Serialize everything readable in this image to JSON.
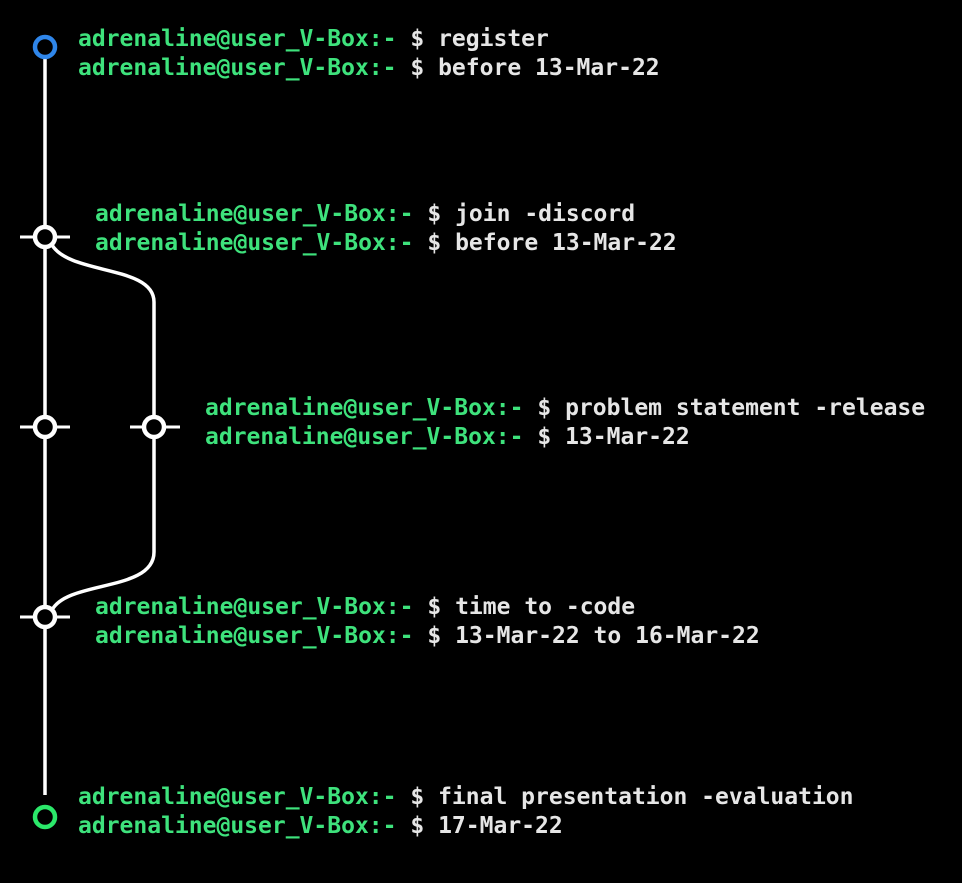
{
  "prompt": {
    "user": "adrenaline@user_V-Box",
    "suffix": ":-",
    "symbol": "$"
  },
  "colors": {
    "background": "#000000",
    "prompt": "#3ee27c",
    "command": "#e6e6e6",
    "line": "#ffffff",
    "start_node": "#2f86ea",
    "end_node": "#2be86a"
  },
  "entries": [
    {
      "command": "register",
      "date": "before 13-Mar-22"
    },
    {
      "command": "join -discord",
      "date": "before 13-Mar-22"
    },
    {
      "command": "problem statement -release",
      "date": "13-Mar-22"
    },
    {
      "command": "time to -code",
      "date": "13-Mar-22 to 16-Mar-22"
    },
    {
      "command": "final presentation -evaluation",
      "date": "17-Mar-22"
    }
  ]
}
